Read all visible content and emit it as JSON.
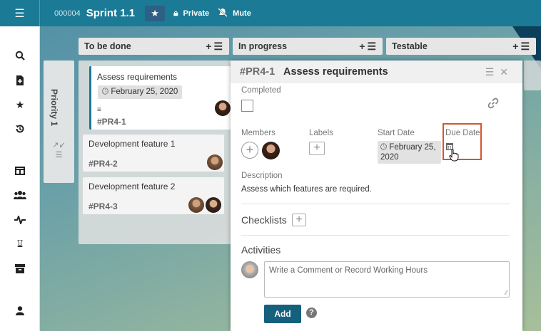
{
  "topbar": {
    "menu_icon": "hamburger-icon",
    "sprint_number": "000004",
    "sprint_title": "Sprint 1.1",
    "star_icon": "star-icon",
    "private_label": "Private",
    "mute_label": "Mute"
  },
  "sidebar": {
    "icons": [
      "search-icon",
      "new-document-icon",
      "favorites-star-icon",
      "history-icon",
      "board-icon",
      "team-icon",
      "activity-icon",
      "hourglass-icon",
      "archive-icon",
      "user-icon"
    ]
  },
  "columns": [
    {
      "title": "To be done"
    },
    {
      "title": "In progress"
    },
    {
      "title": "Testable"
    }
  ],
  "swimlane": {
    "label": "Priority 1"
  },
  "cards": [
    {
      "title": "Assess requirements",
      "date": "February 25, 2020",
      "id": "#PR4-1"
    },
    {
      "title": "Development feature 1",
      "id": "#PR4-2"
    },
    {
      "title": "Development feature 2",
      "id": "#PR4-3"
    }
  ],
  "detail": {
    "id": "#PR4-1",
    "title": "Assess requirements",
    "completed_label": "Completed",
    "members_label": "Members",
    "labels_label": "Labels",
    "start_date_label": "Start Date",
    "start_date_value": "February 25, 2020",
    "due_date_label": "Due Date",
    "description_label": "Description",
    "description_text": "Assess which features are required.",
    "checklists_label": "Checklists",
    "activities_label": "Activities",
    "comment_placeholder": "Write a Comment or Record Working Hours",
    "add_button": "Add"
  },
  "colors": {
    "topbar": "#1b7a95",
    "accent": "#14607d",
    "highlight": "#d9532c"
  }
}
